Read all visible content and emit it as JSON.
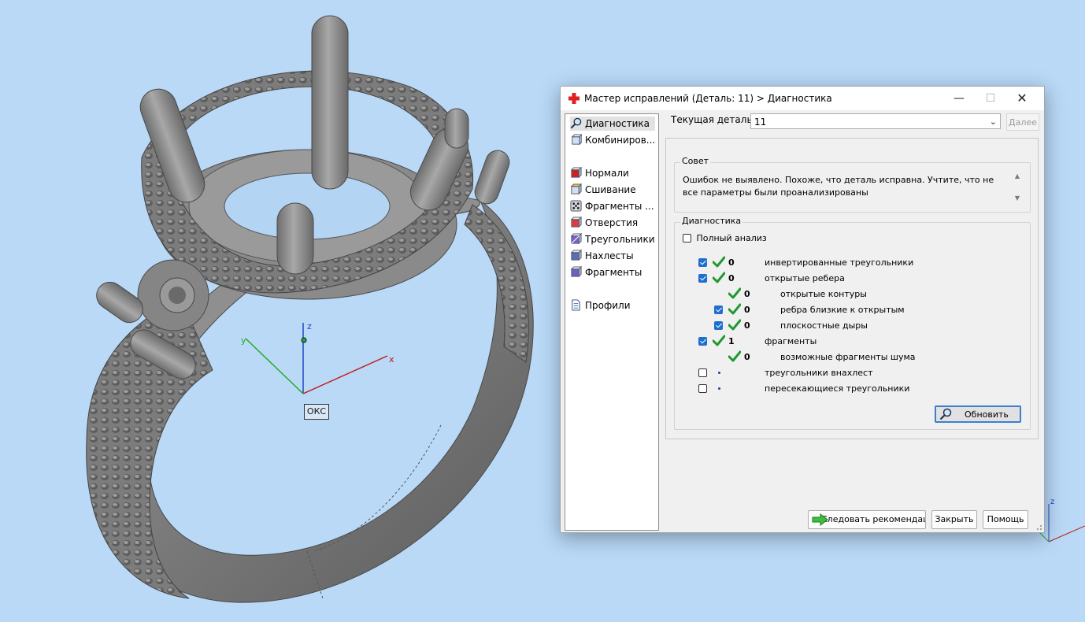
{
  "viewport": {
    "triad_labels": {
      "x": "x",
      "y": "y",
      "z": "z"
    },
    "oks_label": "ОКС",
    "corner_triad_label": "z",
    "colors": {
      "background": "#b9d9f7",
      "model": "#7d7d7d",
      "x_axis": "#c01818",
      "y_axis": "#22aa22",
      "z_axis": "#2244cc"
    }
  },
  "dialog": {
    "title": "Мастер исправлений (Деталь: 11) > Диагностика",
    "window_buttons": {
      "minimize": "—",
      "maximize": "☐",
      "close": "✕"
    },
    "nav": [
      {
        "label": "Диагностика",
        "icon": "magnifier-icon",
        "selected": true
      },
      {
        "label": "Комбиниров...",
        "icon": "combine-cube-icon"
      },
      {
        "label": "Нормали",
        "icon": "normals-cube-icon"
      },
      {
        "label": "Сшивание",
        "icon": "stitch-cube-icon"
      },
      {
        "label": "Фрагменты ...",
        "icon": "fragments-dice-icon"
      },
      {
        "label": "Отверстия",
        "icon": "holes-cube-icon"
      },
      {
        "label": "Треугольники",
        "icon": "triangles-cube-icon"
      },
      {
        "label": "Нахлесты",
        "icon": "overlaps-cube-icon"
      },
      {
        "label": "Фрагменты",
        "icon": "shells-cube-icon"
      },
      {
        "label": "Профили",
        "icon": "profile-document-icon"
      }
    ],
    "current_part": {
      "label": "Текущая деталь:",
      "value": "11"
    },
    "next_button": "Далее",
    "advice": {
      "title": "Совет",
      "text": "Ошибок не выявлено. Похоже, что деталь исправна. Учтите, что не все параметры были проанализированы"
    },
    "diagnostics": {
      "title": "Диагностика",
      "full_analysis": {
        "label": "Полный анализ",
        "checked": false
      },
      "rows": [
        {
          "checkbox": true,
          "checked": true,
          "status": "ok",
          "count": "0",
          "label": "инвертированные треугольники",
          "indent": 0
        },
        {
          "checkbox": true,
          "checked": true,
          "status": "ok",
          "count": "0",
          "label": "открытые ребера",
          "indent": 0
        },
        {
          "checkbox": false,
          "checked": false,
          "status": "ok",
          "count": "0",
          "label": "открытые контуры",
          "indent": 2
        },
        {
          "checkbox": true,
          "checked": true,
          "status": "ok",
          "count": "0",
          "label": "ребра близкие к открытым",
          "indent": 1
        },
        {
          "checkbox": true,
          "checked": true,
          "status": "ok",
          "count": "0",
          "label": "плоскостные дыры",
          "indent": 1
        },
        {
          "checkbox": true,
          "checked": true,
          "status": "ok",
          "count": "1",
          "label": "фрагменты",
          "indent": 0
        },
        {
          "checkbox": false,
          "checked": false,
          "status": "ok",
          "count": "0",
          "label": "возможные фрагменты шума",
          "indent": 1
        },
        {
          "checkbox": true,
          "checked": false,
          "status": "dot",
          "count": "",
          "label": "треугольники внахлест",
          "indent": 0
        },
        {
          "checkbox": true,
          "checked": false,
          "status": "dot",
          "count": "",
          "label": "пересекающиеся треугольники",
          "indent": 0
        }
      ],
      "refresh_button": "Обновить"
    },
    "buttons": {
      "follow": "Следовать рекомендациям",
      "close": "Закрыть",
      "help": "Помощь"
    }
  }
}
